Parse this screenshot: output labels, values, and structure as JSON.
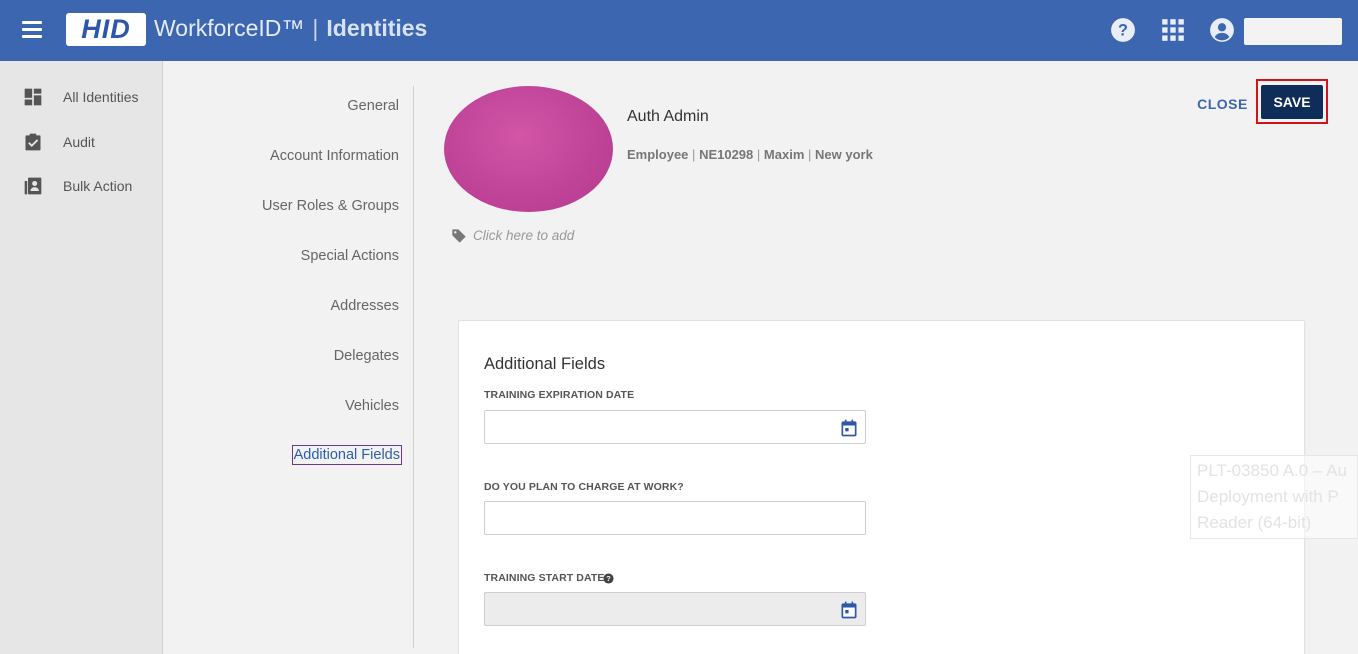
{
  "header": {
    "logo": "HID",
    "product": "WorkforceID™",
    "separator": "|",
    "section": "Identities",
    "bg_color": "#3d66b1"
  },
  "leftnav": {
    "items": [
      {
        "label": "All Identities",
        "icon": "dashboard-icon"
      },
      {
        "label": "Audit",
        "icon": "clipboard-check-icon"
      },
      {
        "label": "Bulk Action",
        "icon": "bulk-contacts-icon"
      }
    ]
  },
  "tabs": {
    "items": [
      {
        "label": "General"
      },
      {
        "label": "Account Information"
      },
      {
        "label": "User Roles & Groups"
      },
      {
        "label": "Special Actions"
      },
      {
        "label": "Addresses"
      },
      {
        "label": "Delegates"
      },
      {
        "label": "Vehicles"
      },
      {
        "label": "Additional Fields",
        "active": true
      }
    ]
  },
  "profile": {
    "name": "Auth Admin",
    "type": "Employee",
    "id": "NE10298",
    "org": "Maxim",
    "location": "New york",
    "tag_placeholder": "Click here to add"
  },
  "actions": {
    "close_label": "CLOSE",
    "save_label": "SAVE"
  },
  "card": {
    "title": "Additional Fields",
    "fields": [
      {
        "label": "TRAINING EXPIRATION DATE",
        "value": "",
        "icon": "calendar-icon"
      },
      {
        "label": "DO YOU PLAN TO CHARGE AT WORK?",
        "value": ""
      },
      {
        "label": "TRAINING START DATE",
        "value": "",
        "icon": "calendar-icon",
        "help": "question-icon",
        "disabled": true
      }
    ]
  },
  "ghost_text": {
    "line1": "PLT-03850 A.0 – Au",
    "line2": "Deployment with P",
    "line3": "Reader (64-bit)"
  }
}
